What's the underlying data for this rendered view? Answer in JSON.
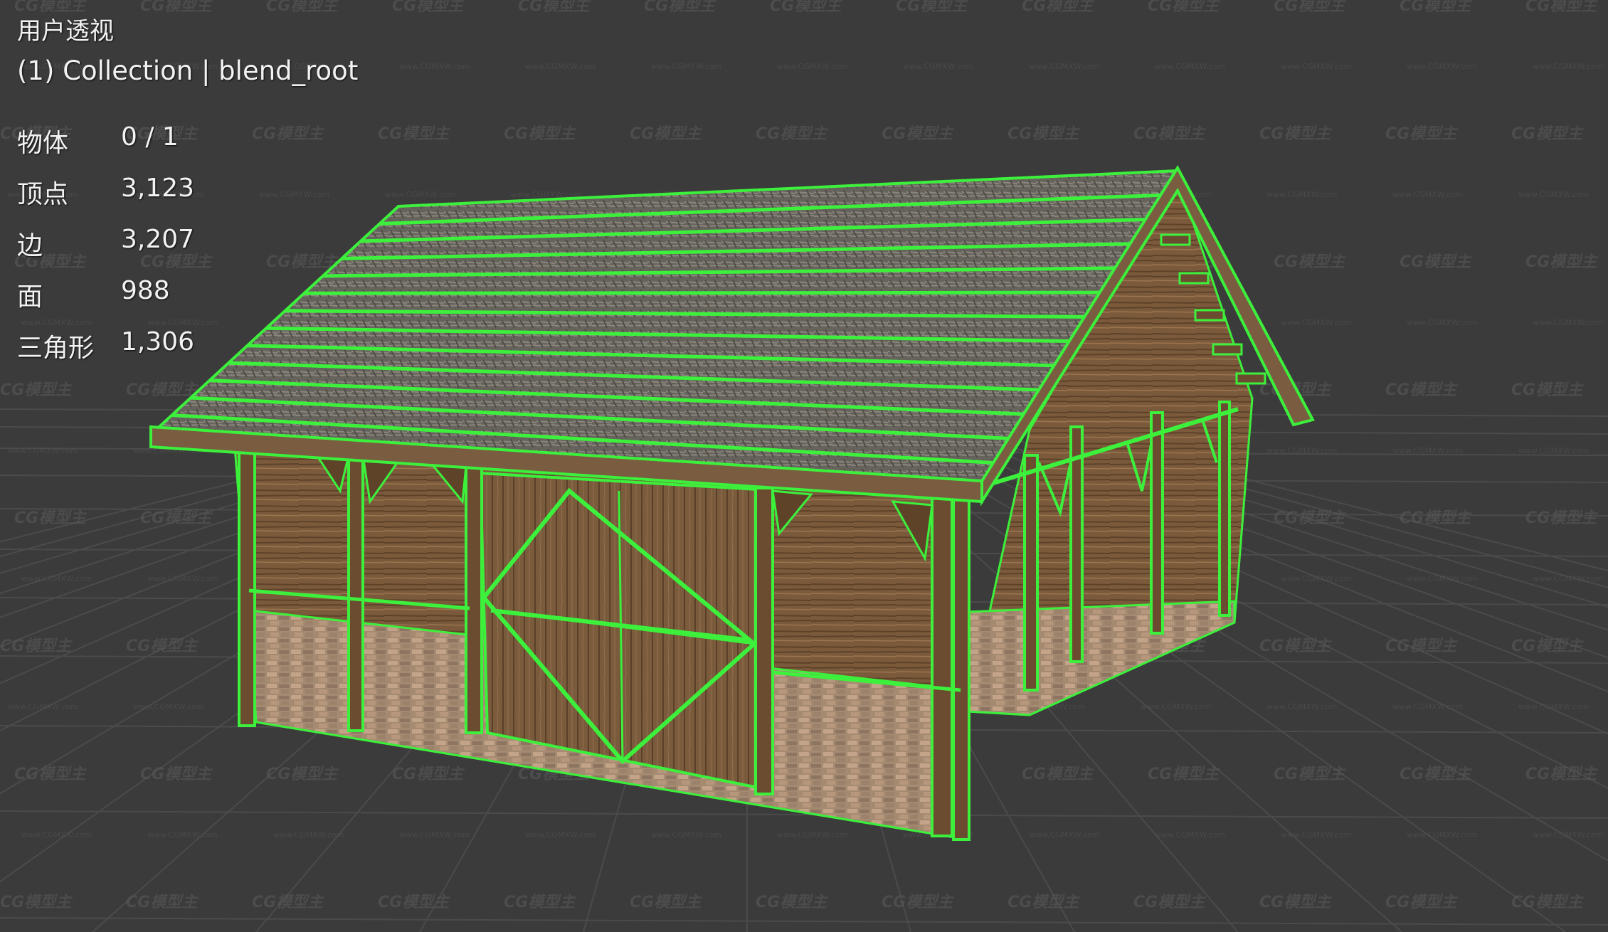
{
  "viewport": {
    "view_name": "用户透视",
    "collection_info": "(1) Collection | blend_root",
    "stats": [
      {
        "label": "物体",
        "value": "0 / 1"
      },
      {
        "label": "顶点",
        "value": "3,123"
      },
      {
        "label": "边",
        "value": "3,207"
      },
      {
        "label": "面",
        "value": "988"
      },
      {
        "label": "三角形",
        "value": "1,306"
      }
    ],
    "watermark_text": "CG模型主",
    "watermark_url": "www.CGMXW.com",
    "colors": {
      "background": "#3b3b3b",
      "grid_line": "#4a4a4a",
      "wireframe": "#3cf03c",
      "wood": "#7a5a3a",
      "roof": "#6e6a62",
      "stone": "#a08670"
    }
  }
}
